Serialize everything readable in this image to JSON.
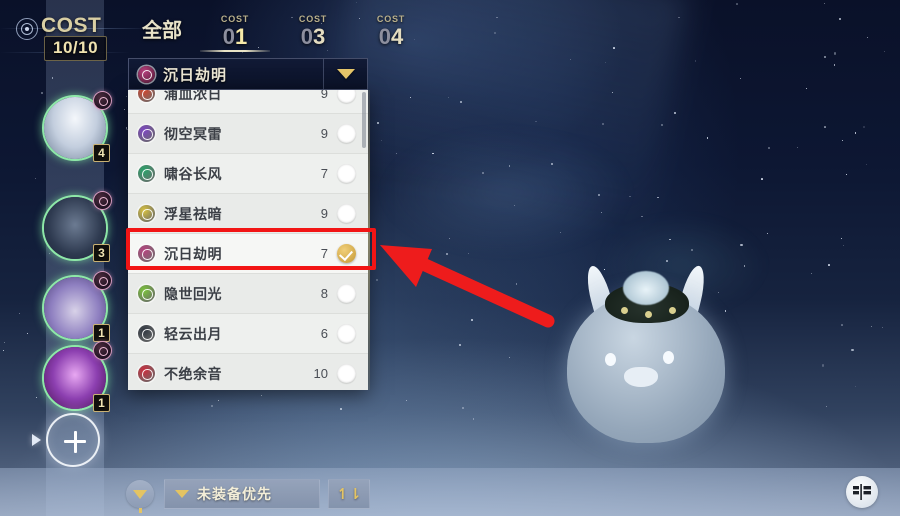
{
  "cost_panel": {
    "label": "COST",
    "value": "10/10",
    "ring_icon": "cost-ring-icon"
  },
  "tabs": [
    {
      "label": "全部",
      "type": "all",
      "active": false
    },
    {
      "label": "COST",
      "num": "01",
      "type": "cost",
      "active": true
    },
    {
      "label": "COST",
      "num": "03",
      "type": "cost",
      "active": false
    },
    {
      "label": "COST",
      "num": "04",
      "type": "cost",
      "active": false
    }
  ],
  "dropdown": {
    "selected_label": "沉日劫明",
    "selected_icon_color": "#b8417e",
    "chevron_icon": "chevron-down-icon",
    "items": [
      {
        "name": "浦血浓日",
        "count": "9",
        "color": "#d2452c",
        "checked": false,
        "partial": true
      },
      {
        "name": "彻空冥雷",
        "count": "9",
        "color": "#7d45c4",
        "checked": false
      },
      {
        "name": "啸谷长风",
        "count": "7",
        "color": "#27a36a",
        "checked": false
      },
      {
        "name": "浮星祛暗",
        "count": "9",
        "color": "#d9c23f",
        "checked": false
      },
      {
        "name": "沉日劫明",
        "count": "7",
        "color": "#b8417e",
        "checked": true,
        "highlighted": true
      },
      {
        "name": "隐世回光",
        "count": "8",
        "color": "#7bc43a",
        "checked": false
      },
      {
        "name": "轻云出月",
        "count": "6",
        "color": "#2f3640",
        "checked": false
      },
      {
        "name": "不绝余音",
        "count": "10",
        "color": "#cc2b3c",
        "checked": false
      }
    ]
  },
  "characters": [
    {
      "cost": "4",
      "element_icon": "element-badge-icon"
    },
    {
      "cost": "3",
      "element_icon": "element-badge-icon"
    },
    {
      "cost": "1",
      "element_icon": "element-badge-icon"
    },
    {
      "cost": "1",
      "element_icon": "element-badge-icon"
    }
  ],
  "add_button": {
    "icon": "plus-icon",
    "arrow_icon": "triangle-right-icon"
  },
  "bottom_bar": {
    "filter_icon": "funnel-icon",
    "sort_label": "未装备优先",
    "sort_chevron_icon": "chevron-down-icon",
    "order_icon": "↿⇂",
    "order_icon_name": "sort-order-icon",
    "layout_icon_name": "layout-align-icon"
  },
  "annotation": {
    "arrow_color": "#ee1c1c",
    "highlight_color": "#f21515"
  },
  "colors": {
    "accent_gold": "#e6c66a",
    "panel_dark": "#0b1228",
    "list_bg": "#eef0ee"
  }
}
